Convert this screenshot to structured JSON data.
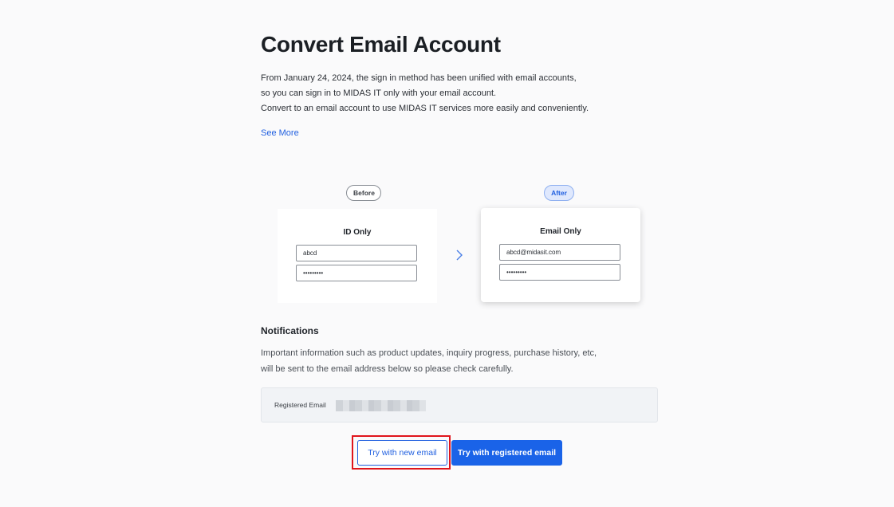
{
  "header": {
    "title": "Convert Email Account",
    "description": [
      "From January 24, 2024, the sign in method has been unified with email accounts,",
      "so you can sign in to MIDAS IT only with your email account.",
      "Convert to an email account to use MIDAS IT services more easily and conveniently."
    ],
    "see_more": "See More"
  },
  "comparison": {
    "before": {
      "badge": "Before",
      "card_title": "ID Only",
      "field_1": "abcd",
      "field_2": "•••••••••"
    },
    "after": {
      "badge": "After",
      "card_title": "Email Only",
      "field_1": "abcd@midasit.com",
      "field_2": "•••••••••"
    },
    "arrow_icon": "chevron-right-icon"
  },
  "notifications": {
    "title": "Notifications",
    "description": [
      "Important information such as product updates, inquiry progress, purchase history, etc,",
      "will be sent to the email address below so please check carefully."
    ],
    "registered_email_label": "Registered Email"
  },
  "actions": {
    "new_email": "Try with new email",
    "registered_email": "Try with registered email"
  },
  "colors": {
    "accent": "#1a63e8",
    "highlight": "#e0151c"
  }
}
